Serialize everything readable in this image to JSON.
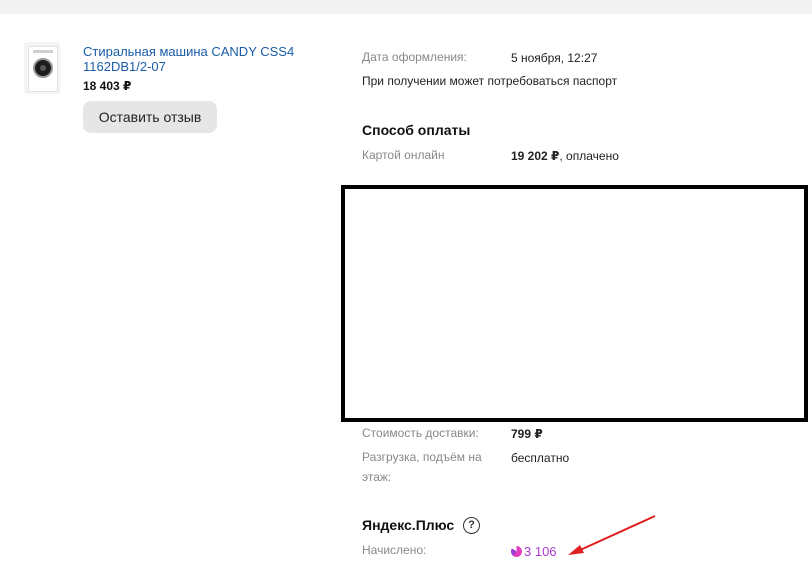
{
  "product": {
    "title": "Стиральная машина CANDY CSS4 1162DB1/2-07",
    "price": "18 403 ₽",
    "review_button": "Оставить отзыв",
    "image_icon": "washing-machine-image"
  },
  "order": {
    "date_label": "Дата оформления:",
    "date_value": "5 ноября, 12:27",
    "passport_note": "При получении может потребоваться паспорт"
  },
  "payment": {
    "heading": "Способ оплаты",
    "method_label": "Картой онлайн",
    "amount": "19 202 ₽",
    "status": ", оплачено"
  },
  "delivery": {
    "cost_label": "Стоимость доставки:",
    "cost_value": "799 ₽",
    "lift_label_line1": "Разгрузка, подъём на",
    "lift_label_line2": "этаж:",
    "lift_value": "бесплатно"
  },
  "plus": {
    "heading": "Яндекс.Плюс",
    "help_icon": "?",
    "accrued_label": "Начислено:",
    "accrued_value": "3 106",
    "icon": "yandex-plus-icon"
  },
  "colors": {
    "link": "#1a5ca8",
    "plus_purple": "#a83bd0",
    "annotation_arrow": "#e02020",
    "redaction_border": "#000000"
  }
}
